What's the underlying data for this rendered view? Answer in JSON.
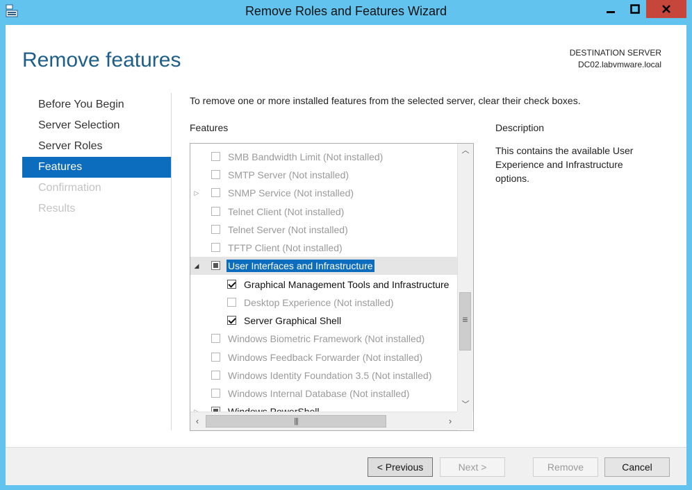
{
  "window": {
    "title": "Remove Roles and Features Wizard",
    "minimize_icon": "minimize-icon",
    "maximize_icon": "maximize-icon",
    "close_icon": "close-icon",
    "close_color": "#c7463c"
  },
  "page": {
    "title": "Remove features",
    "destination_label": "DESTINATION SERVER",
    "destination_server": "DC02.labvmware.local"
  },
  "nav": {
    "items": [
      {
        "label": "Before You Begin",
        "state": "normal"
      },
      {
        "label": "Server Selection",
        "state": "normal"
      },
      {
        "label": "Server Roles",
        "state": "normal"
      },
      {
        "label": "Features",
        "state": "active"
      },
      {
        "label": "Confirmation",
        "state": "disabled"
      },
      {
        "label": "Results",
        "state": "disabled"
      }
    ],
    "accent": "#0c6cbd"
  },
  "main": {
    "instruction": "To remove one or more installed features from the selected server, clear their check boxes.",
    "features_label": "Features",
    "description_label": "Description",
    "description_text": "This contains the available User Experience and Infrastructure options."
  },
  "features": [
    {
      "label": "SMB Bandwidth Limit (Not installed)",
      "state": "unchecked",
      "installed": false
    },
    {
      "label": "SMTP Server (Not installed)",
      "state": "unchecked",
      "installed": false
    },
    {
      "label": "SNMP Service (Not installed)",
      "state": "unchecked",
      "installed": false
    },
    {
      "label": "Telnet Client (Not installed)",
      "state": "unchecked",
      "installed": false
    },
    {
      "label": "Telnet Server (Not installed)",
      "state": "unchecked",
      "installed": false
    },
    {
      "label": "TFTP Client (Not installed)",
      "state": "unchecked",
      "installed": false
    },
    {
      "label": "User Interfaces and Infrastructure",
      "state": "partial",
      "installed": true,
      "selected": true
    },
    {
      "label": "Graphical Management Tools and Infrastructure",
      "state": "checked",
      "installed": true
    },
    {
      "label": "Desktop Experience (Not installed)",
      "state": "unchecked",
      "installed": false
    },
    {
      "label": "Server Graphical Shell",
      "state": "checked",
      "installed": true
    },
    {
      "label": "Windows Biometric Framework (Not installed)",
      "state": "unchecked",
      "installed": false
    },
    {
      "label": "Windows Feedback Forwarder (Not installed)",
      "state": "unchecked",
      "installed": false
    },
    {
      "label": "Windows Identity Foundation 3.5 (Not installed)",
      "state": "unchecked",
      "installed": false
    },
    {
      "label": "Windows Internal Database (Not installed)",
      "state": "unchecked",
      "installed": false
    },
    {
      "label": "Windows PowerShell",
      "state": "partial",
      "installed": true
    }
  ],
  "scrollbars": {
    "up_icon": "scroll-up-icon",
    "down_icon": "scroll-down-icon",
    "left_icon": "scroll-left-icon",
    "right_icon": "scroll-right-icon"
  },
  "footer": {
    "previous_label": "< Previous",
    "next_label": "Next >",
    "remove_label": "Remove",
    "cancel_label": "Cancel"
  }
}
